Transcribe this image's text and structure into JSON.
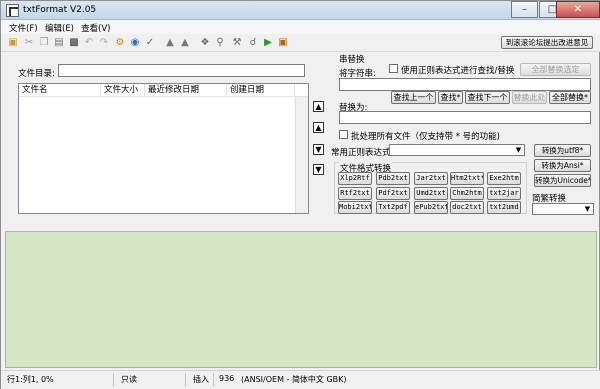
{
  "window": {
    "title": "txtFormat V2.05"
  },
  "menu": [
    "文件(F)",
    "编辑(E)",
    "查看(V)"
  ],
  "toolbar": {
    "icons": [
      "open-icon",
      "cut-icon",
      "copy-icon",
      "paste-icon",
      "save-icon",
      "undo-icon",
      "redo-icon",
      "settings-icon",
      "web-icon",
      "checkmark-icon",
      "stamp-icon",
      "stamp2-icon",
      "tool-icon",
      "key-icon",
      "wrench-icon",
      "find-icon",
      "run-icon",
      "image-icon"
    ],
    "forum_button": "到滚滚论坛提出改进意见"
  },
  "file_panel": {
    "dir_label": "文件目录:",
    "dir_value": "",
    "columns": [
      "文件名",
      "文件大小",
      "最近修改日期",
      "创建日期"
    ],
    "rows": []
  },
  "replace": {
    "group_label": "串替换",
    "find_label": "将字符串:",
    "regex_check_label": "使用正则表达式进行查找/替换",
    "replace_all_selected": "全部替换选定",
    "find_prev": "查找上一个",
    "find_star": "查找*",
    "find_next": "查找下一个",
    "replace_here": "替换此处",
    "replace_all": "全部替换*",
    "replace_with_label": "替换为:",
    "batch_label": "批处理所有文件（仅支持带 * 号的功能)",
    "regex_common_label": "常用正则表达式"
  },
  "convert": {
    "group_label": "文件格式转换",
    "formats": [
      [
        "Xlp2Rtf",
        "Pdb2txt",
        "Jar2txt",
        "Htm2txt*",
        "Exe2htm"
      ],
      [
        "Rtf2txt",
        "Pdf2txt",
        "Umd2txt",
        "Chm2htm",
        "txt2jar"
      ],
      [
        "Mobi2txt",
        "Txt2pdf",
        "ePub2txt",
        "doc2txt",
        "txt2umd"
      ]
    ],
    "to_utf8": "转换为utf8*",
    "to_ansi": "转换为Ansi*",
    "to_unicode": "转换为Unicode*",
    "simp_trad_label": "简繁转换",
    "simp_trad_value": ""
  },
  "status": {
    "position": "行1:列1, 0%",
    "mode": "只读",
    "insert": "插入",
    "count": "936",
    "encoding": "(ANSI/OEM - 简体中文 GBK)"
  }
}
